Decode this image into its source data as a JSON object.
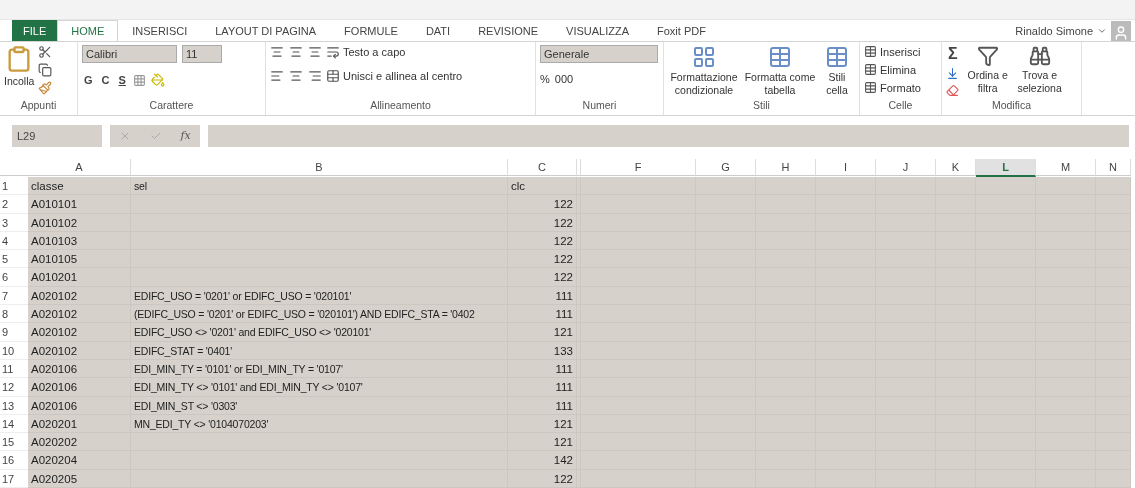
{
  "ribbon_tabs": [
    {
      "label": "FILE",
      "kind": "file",
      "selected": false
    },
    {
      "label": "HOME",
      "kind": "tab",
      "selected": true
    },
    {
      "label": "INSERISCI",
      "kind": "tab",
      "selected": false
    },
    {
      "label": "LAYOUT DI PAGINA",
      "kind": "tab",
      "selected": false
    },
    {
      "label": "FORMULE",
      "kind": "tab",
      "selected": false
    },
    {
      "label": "DATI",
      "kind": "tab",
      "selected": false
    },
    {
      "label": "REVISIONE",
      "kind": "tab",
      "selected": false
    },
    {
      "label": "VISUALIZZA",
      "kind": "tab",
      "selected": false
    },
    {
      "label": "Foxit PDF",
      "kind": "tab",
      "selected": false
    }
  ],
  "user": {
    "name": "Rinaldo Simone"
  },
  "ribbon": {
    "clipboard": {
      "paste": "Incolla",
      "label": "Appunti"
    },
    "font": {
      "name": "Calibri",
      "size": "11",
      "bold": "G",
      "italic": "C",
      "underline": "S",
      "label": "Carattere"
    },
    "alignment": {
      "wrap": "Testo a capo",
      "merge": "Unisci e allinea al centro",
      "label": "Allineamento"
    },
    "number": {
      "format": "Generale",
      "percent": "%",
      "thousands": "000",
      "label": "Numeri"
    },
    "styles": {
      "items": [
        "Formattazione condizionale",
        "Formatta come tabella",
        "Stili cella"
      ],
      "label": "Stili"
    },
    "cells": {
      "items": [
        "Inserisci",
        "Elimina",
        "Formato"
      ],
      "label": "Celle"
    },
    "editing": {
      "sum": "Σ",
      "items": [
        "Ordina e filtra",
        "Trova e seleziona"
      ],
      "label": "Modifica"
    }
  },
  "formula_bar": {
    "name_box": "L29",
    "fx": "fx"
  },
  "columns": [
    {
      "label": "A",
      "selected": false
    },
    {
      "label": "B",
      "selected": false
    },
    {
      "label": "C",
      "selected": false
    },
    {
      "label": "F",
      "selected": false
    },
    {
      "label": "G",
      "selected": false
    },
    {
      "label": "H",
      "selected": false
    },
    {
      "label": "I",
      "selected": false
    },
    {
      "label": "J",
      "selected": false
    },
    {
      "label": "K",
      "selected": false
    },
    {
      "label": "L",
      "selected": true
    },
    {
      "label": "M",
      "selected": false
    },
    {
      "label": "N",
      "selected": false
    }
  ],
  "rows": [
    {
      "n": "1",
      "a": "classe",
      "b": "sel",
      "c": "clc"
    },
    {
      "n": "2",
      "a": "A010101",
      "c": "122"
    },
    {
      "n": "3",
      "a": "A010102",
      "c": "122"
    },
    {
      "n": "4",
      "a": "A010103",
      "c": "122"
    },
    {
      "n": "5",
      "a": "A010105",
      "c": "122"
    },
    {
      "n": "6",
      "a": "A010201",
      "c": "122"
    },
    {
      "n": "7",
      "a": "A020102",
      "b": "EDIFC_USO = '0201' or EDIFC_USO = '020101'",
      "c": "111"
    },
    {
      "n": "8",
      "a": "A020102",
      "b": "(EDIFC_USO = '0201' or EDIFC_USO = '020101') AND EDIFC_STA = '0402",
      "c": "111"
    },
    {
      "n": "9",
      "a": "A020102",
      "b": "EDIFC_USO <> '0201' and EDIFC_USO <> '020101'",
      "c": "121"
    },
    {
      "n": "10",
      "a": "A020102",
      "b": "EDIFC_STAT = '0401'",
      "c": "133"
    },
    {
      "n": "11",
      "a": "A020106",
      "b": "EDI_MIN_TY = '0101' or EDI_MIN_TY = '0107'",
      "c": "111"
    },
    {
      "n": "12",
      "a": "A020106",
      "b": "EDI_MIN_TY <> '0101' and EDI_MIN_TY <> '0107'",
      "c": "111"
    },
    {
      "n": "13",
      "a": "A020106",
      "b": "EDI_MIN_ST <> '0303'",
      "c": "111"
    },
    {
      "n": "14",
      "a": "A020201",
      "b": "MN_EDI_TY <> '0104070203'",
      "c": "121"
    },
    {
      "n": "15",
      "a": "A020202",
      "c": "121"
    },
    {
      "n": "16",
      "a": "A020204",
      "c": "142"
    },
    {
      "n": "17",
      "a": "A020205",
      "c": "122"
    }
  ]
}
